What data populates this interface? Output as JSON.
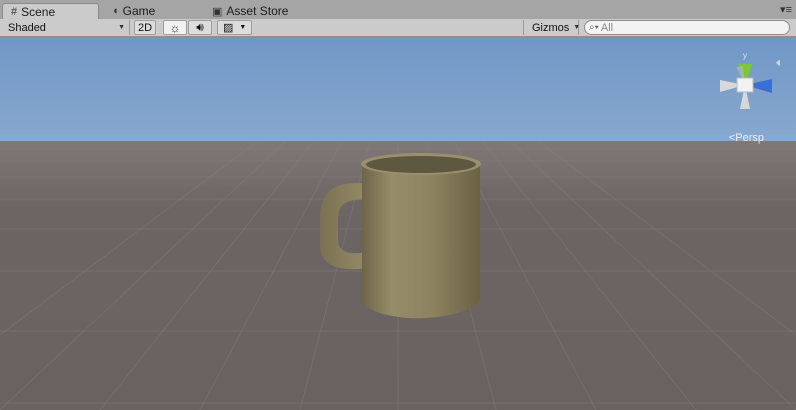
{
  "tabs": [
    {
      "label": "Scene",
      "icon": "grid-icon"
    },
    {
      "label": "Game",
      "icon": "pacman-icon"
    },
    {
      "label": "Asset Store",
      "icon": "store-icon"
    }
  ],
  "toolbar": {
    "shading_mode": "Shaded",
    "mode_2d": "2D",
    "gizmos_label": "Gizmos",
    "search_placeholder": "All"
  },
  "viewport": {
    "projection_label": "Persp",
    "axis_y": "y",
    "object": "mug",
    "object_color": "#8b8160"
  }
}
